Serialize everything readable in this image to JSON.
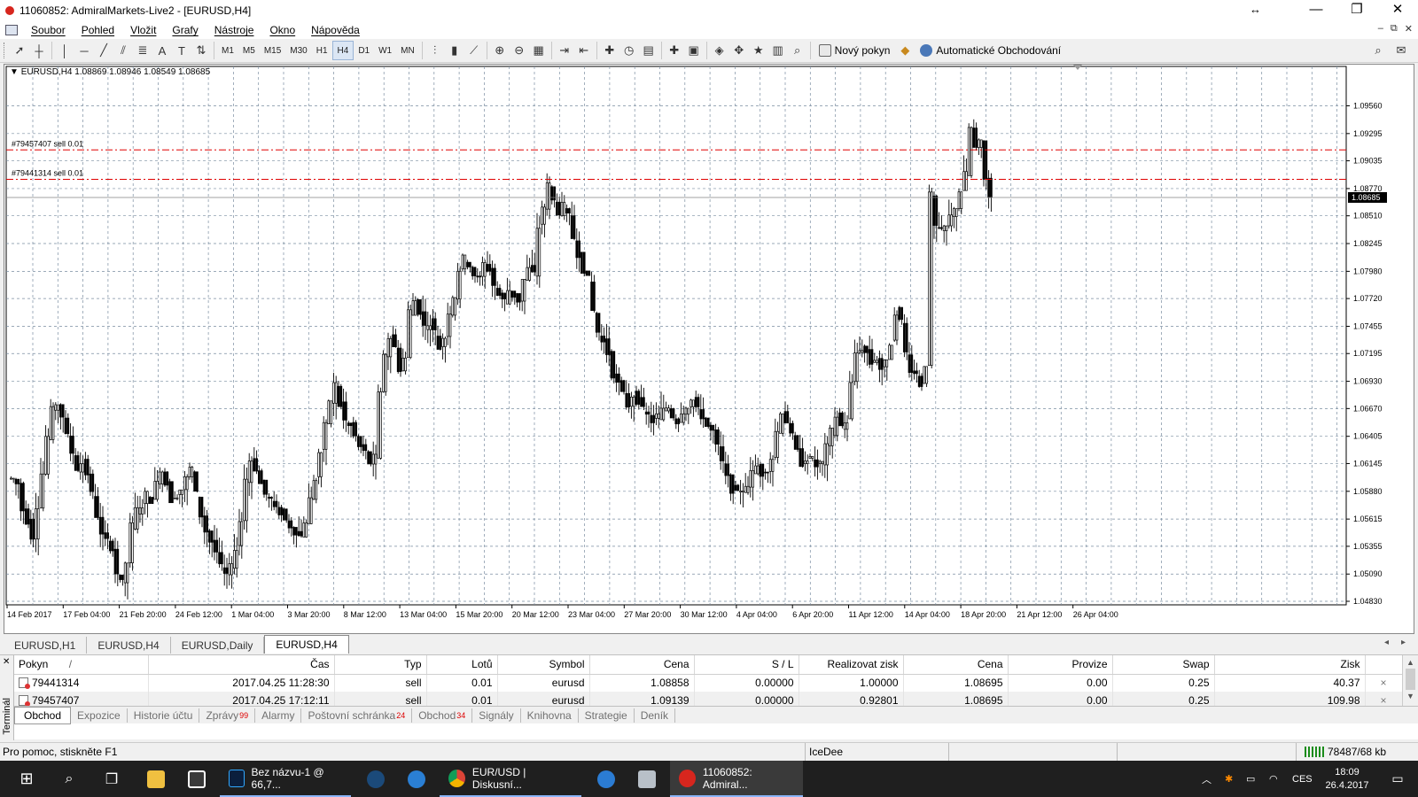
{
  "window": {
    "title": "11060852: AdmiralMarkets-Live2 - [EURUSD,H4]",
    "resize_icon": "resize-arrows-icon",
    "min": "—",
    "max": "❐",
    "close": "✕"
  },
  "menu": {
    "items": [
      "Soubor",
      "Pohled",
      "Vložit",
      "Grafy",
      "Nástroje",
      "Okno",
      "Nápověda"
    ],
    "mdi_min": "–",
    "mdi_restore": "⧉",
    "mdi_close": "✕"
  },
  "toolbar": {
    "timeframes": [
      "M1",
      "M5",
      "M15",
      "M30",
      "H1",
      "H4",
      "D1",
      "W1",
      "MN"
    ],
    "active_timeframe": "H4",
    "new_order_label": "Nový pokyn",
    "auto_trading_label": "Automatické Obchodování"
  },
  "chart": {
    "header": "EURUSD,H4  1.08869 1.08946 1.08549 1.08685",
    "current_price": "1.08685",
    "colors": {
      "order_line": "#e00000",
      "price_line": "#808080",
      "grid": "#7a8da0",
      "candles": "#000000",
      "current_price_bg": "#000000"
    }
  },
  "chart_data": {
    "type": "candlestick",
    "symbol": "EURUSD",
    "timeframe": "H4",
    "ohlc": {
      "open": 1.08869,
      "high": 1.08946,
      "low": 1.08549,
      "close": 1.08685
    },
    "ylim": [
      1.0483,
      1.0975
    ],
    "y_ticks": [
      "1.09560",
      "1.09295",
      "1.09035",
      "1.08770",
      "1.08510",
      "1.08245",
      "1.07980",
      "1.07720",
      "1.07455",
      "1.07195",
      "1.06930",
      "1.06670",
      "1.06405",
      "1.06145",
      "1.05880",
      "1.05615",
      "1.05355",
      "1.05090",
      "1.04830"
    ],
    "x_ticks": [
      "14 Feb 2017",
      "17 Feb 04:00",
      "21 Feb 20:00",
      "24 Feb 12:00",
      "1 Mar 04:00",
      "3 Mar 20:00",
      "8 Mar 12:00",
      "13 Mar 04:00",
      "15 Mar 20:00",
      "20 Mar 12:00",
      "23 Mar 04:00",
      "27 Mar 20:00",
      "30 Mar 12:00",
      "4 Apr 04:00",
      "6 Apr 20:00",
      "11 Apr 12:00",
      "14 Apr 04:00",
      "18 Apr 20:00",
      "21 Apr 12:00",
      "26 Apr 04:00"
    ],
    "price_path": [
      [
        0,
        1.06
      ],
      [
        1,
        1.0595
      ],
      [
        2,
        1.057
      ],
      [
        3,
        1.056
      ],
      [
        4,
        1.0545
      ],
      [
        5,
        1.0575
      ],
      [
        6,
        1.0605
      ],
      [
        7,
        1.064
      ],
      [
        8,
        1.0665
      ],
      [
        9,
        1.0672
      ],
      [
        10,
        1.066
      ],
      [
        11,
        1.064
      ],
      [
        12,
        1.0625
      ],
      [
        13,
        1.061
      ],
      [
        14,
        1.0615
      ],
      [
        15,
        1.0605
      ],
      [
        16,
        1.0585
      ],
      [
        17,
        1.0565
      ],
      [
        18,
        1.0545
      ],
      [
        19,
        1.054
      ],
      [
        20,
        1.0535
      ],
      [
        21,
        1.051
      ],
      [
        22,
        1.05
      ],
      [
        23,
        1.052
      ],
      [
        24,
        1.0555
      ],
      [
        25,
        1.057
      ],
      [
        26,
        1.0575
      ],
      [
        27,
        1.0585
      ],
      [
        28,
        1.058
      ],
      [
        29,
        1.0595
      ],
      [
        30,
        1.061
      ],
      [
        31,
        1.0595
      ],
      [
        32,
        1.058
      ],
      [
        33,
        1.0585
      ],
      [
        34,
        1.059
      ],
      [
        35,
        1.06
      ],
      [
        36,
        1.061
      ],
      [
        37,
        1.0585
      ],
      [
        38,
        1.0565
      ],
      [
        39,
        1.055
      ],
      [
        40,
        1.054
      ],
      [
        41,
        1.053
      ],
      [
        42,
        1.0515
      ],
      [
        43,
        1.0508
      ],
      [
        44,
        1.0515
      ],
      [
        45,
        1.0535
      ],
      [
        46,
        1.056
      ],
      [
        47,
        1.06
      ],
      [
        48,
        1.0618
      ],
      [
        49,
        1.061
      ],
      [
        50,
        1.0595
      ],
      [
        51,
        1.0585
      ],
      [
        52,
        1.058
      ],
      [
        53,
        1.057
      ],
      [
        54,
        1.0568
      ],
      [
        55,
        1.056
      ],
      [
        56,
        1.0555
      ],
      [
        57,
        1.055
      ],
      [
        58,
        1.0545
      ],
      [
        59,
        1.056
      ],
      [
        60,
        1.058
      ],
      [
        61,
        1.06
      ],
      [
        62,
        1.0625
      ],
      [
        63,
        1.065
      ],
      [
        64,
        1.0675
      ],
      [
        65,
        1.069
      ],
      [
        66,
        1.067
      ],
      [
        67,
        1.0655
      ],
      [
        68,
        1.065
      ],
      [
        69,
        1.064
      ],
      [
        70,
        1.063
      ],
      [
        71,
        1.0625
      ],
      [
        72,
        1.0615
      ],
      [
        73,
        1.062
      ],
      [
        74,
        1.068
      ],
      [
        75,
        1.072
      ],
      [
        76,
        1.0735
      ],
      [
        77,
        1.0725
      ],
      [
        78,
        1.0705
      ],
      [
        79,
        1.0715
      ],
      [
        80,
        1.076
      ],
      [
        81,
        1.077
      ],
      [
        82,
        1.076
      ],
      [
        83,
        1.0745
      ],
      [
        84,
        1.075
      ],
      [
        85,
        1.074
      ],
      [
        86,
        1.0725
      ],
      [
        87,
        1.0735
      ],
      [
        88,
        1.076
      ],
      [
        89,
        1.0775
      ],
      [
        90,
        1.08
      ],
      [
        91,
        1.081
      ],
      [
        92,
        1.0805
      ],
      [
        93,
        1.0795
      ],
      [
        94,
        1.079
      ],
      [
        95,
        1.0805
      ],
      [
        96,
        1.08
      ],
      [
        97,
        1.0785
      ],
      [
        98,
        1.0775
      ],
      [
        99,
        1.077
      ],
      [
        100,
        1.078
      ],
      [
        101,
        1.0775
      ],
      [
        102,
        1.077
      ],
      [
        103,
        1.079
      ],
      [
        104,
        1.08
      ],
      [
        105,
        1.0795
      ],
      [
        106,
        1.084
      ],
      [
        107,
        1.086
      ],
      [
        108,
        1.088
      ],
      [
        109,
        1.0865
      ],
      [
        110,
        1.0855
      ],
      [
        111,
        1.086
      ],
      [
        112,
        1.085
      ],
      [
        113,
        1.083
      ],
      [
        114,
        1.0815
      ],
      [
        115,
        1.08
      ],
      [
        116,
        1.079
      ],
      [
        117,
        1.076
      ],
      [
        118,
        1.074
      ],
      [
        119,
        1.073
      ],
      [
        120,
        1.072
      ],
      [
        121,
        1.07
      ],
      [
        122,
        1.069
      ],
      [
        123,
        1.068
      ],
      [
        124,
        1.067
      ],
      [
        125,
        1.068
      ],
      [
        126,
        1.0675
      ],
      [
        127,
        1.0665
      ],
      [
        128,
        1.066
      ],
      [
        129,
        1.0655
      ],
      [
        130,
        1.066
      ],
      [
        131,
        1.0665
      ],
      [
        132,
        1.0668
      ],
      [
        133,
        1.066
      ],
      [
        134,
        1.0655
      ],
      [
        135,
        1.0665
      ],
      [
        136,
        1.067
      ],
      [
        137,
        1.0675
      ],
      [
        138,
        1.0665
      ],
      [
        139,
        1.066
      ],
      [
        140,
        1.065
      ],
      [
        141,
        1.0645
      ],
      [
        142,
        1.063
      ],
      [
        143,
        1.0615
      ],
      [
        144,
        1.06
      ],
      [
        145,
        1.059
      ],
      [
        146,
        1.0585
      ],
      [
        147,
        1.059
      ],
      [
        148,
        1.0595
      ],
      [
        149,
        1.0605
      ],
      [
        150,
        1.0612
      ],
      [
        151,
        1.0605
      ],
      [
        152,
        1.061
      ],
      [
        153,
        1.062
      ],
      [
        154,
        1.0645
      ],
      [
        155,
        1.0665
      ],
      [
        156,
        1.0655
      ],
      [
        157,
        1.064
      ],
      [
        158,
        1.0625
      ],
      [
        159,
        1.0615
      ],
      [
        160,
        1.062
      ],
      [
        161,
        1.0618
      ],
      [
        162,
        1.0612
      ],
      [
        163,
        1.0615
      ],
      [
        164,
        1.063
      ],
      [
        165,
        1.0645
      ],
      [
        166,
        1.066
      ],
      [
        167,
        1.065
      ],
      [
        168,
        1.0655
      ],
      [
        169,
        1.069
      ],
      [
        170,
        1.072
      ],
      [
        171,
        1.0725
      ],
      [
        172,
        1.072
      ],
      [
        173,
        1.071
      ],
      [
        174,
        1.0715
      ],
      [
        175,
        1.0705
      ],
      [
        176,
        1.071
      ],
      [
        177,
        1.073
      ],
      [
        178,
        1.076
      ],
      [
        179,
        1.075
      ],
      [
        180,
        1.072
      ],
      [
        181,
        1.0705
      ],
      [
        182,
        1.07
      ],
      [
        183,
        1.069
      ],
      [
        184,
        1.071
      ],
      [
        185,
        1.087
      ],
      [
        186,
        1.084
      ],
      [
        187,
        1.0835
      ],
      [
        188,
        1.084
      ],
      [
        189,
        1.085
      ],
      [
        190,
        1.086
      ],
      [
        191,
        1.0875
      ],
      [
        192,
        1.089
      ],
      [
        193,
        1.0935
      ],
      [
        194,
        1.0915
      ],
      [
        195,
        1.092
      ],
      [
        196,
        1.0885
      ],
      [
        197,
        1.0869
      ]
    ],
    "last_candle": {
      "open": 1.08869,
      "high": 1.08946,
      "low": 1.08549,
      "close": 1.08685
    },
    "order_lines": [
      {
        "label": "#79457407 sell 0.01",
        "price": 1.09139
      },
      {
        "label": "#79441314 sell 0.01",
        "price": 1.08858
      }
    ],
    "grid": true
  },
  "chart_tabs": {
    "items": [
      "EURUSD,H1",
      "EURUSD,H4",
      "EURUSD,Daily",
      "EURUSD,H4"
    ],
    "active_index": 3,
    "scroll_left": "◂",
    "scroll_right": "▸"
  },
  "terminal": {
    "side_label": "Terminál",
    "close": "✕",
    "columns": [
      "Pokyn",
      "Čas",
      "Typ",
      "Lotů",
      "Symbol",
      "Cena",
      "S / L",
      "Realizovat zisk",
      "Cena",
      "Provize",
      "Swap",
      "Zisk"
    ],
    "sort_marker": "/",
    "rows": [
      {
        "pokyn": "79441314",
        "cas": "2017.04.25 11:28:30",
        "typ": "sell",
        "lotu": "0.01",
        "symbol": "eurusd",
        "cena": "1.08858",
        "sl": "0.00000",
        "tp": "1.00000",
        "cena2": "1.08695",
        "provize": "0.00",
        "swap": "0.25",
        "zisk": "40.37",
        "close": "×"
      },
      {
        "pokyn": "79457407",
        "cas": "2017.04.25 17:12:11",
        "typ": "sell",
        "lotu": "0.01",
        "symbol": "eurusd",
        "cena": "1.09139",
        "sl": "0.00000",
        "tp": "0.92801",
        "cena2": "1.08695",
        "provize": "0.00",
        "swap": "0.25",
        "zisk": "109.98",
        "close": "×"
      }
    ],
    "scroll_up": "▲",
    "scroll_down": "▼",
    "tabs": [
      {
        "label": "Obchod",
        "badge": ""
      },
      {
        "label": "Expozice",
        "badge": ""
      },
      {
        "label": "Historie účtu",
        "badge": ""
      },
      {
        "label": "Zprávy",
        "badge": "99"
      },
      {
        "label": "Alarmy",
        "badge": ""
      },
      {
        "label": "Poštovní schránka",
        "badge": "24"
      },
      {
        "label": "Obchod",
        "badge": "34"
      },
      {
        "label": "Signály",
        "badge": ""
      },
      {
        "label": "Knihovna",
        "badge": ""
      },
      {
        "label": "Strategie",
        "badge": ""
      },
      {
        "label": "Deník",
        "badge": ""
      }
    ],
    "active_tab": 0
  },
  "status": {
    "help": "Pro pomoc, stiskněte F1",
    "profile": "IceDee",
    "connection": "78487/68 kb"
  },
  "taskbar": {
    "apps": [
      {
        "label": "Bez názvu-1 @ 66,7...",
        "icon": "photoshop-icon"
      },
      {
        "label": "EUR/USD | Diskusní...",
        "icon": "chrome-icon"
      },
      {
        "label": "11060852: Admiral...",
        "icon": "mt4-icon"
      }
    ],
    "language": "CES",
    "time": "18:09",
    "date": "26.4.2017"
  }
}
